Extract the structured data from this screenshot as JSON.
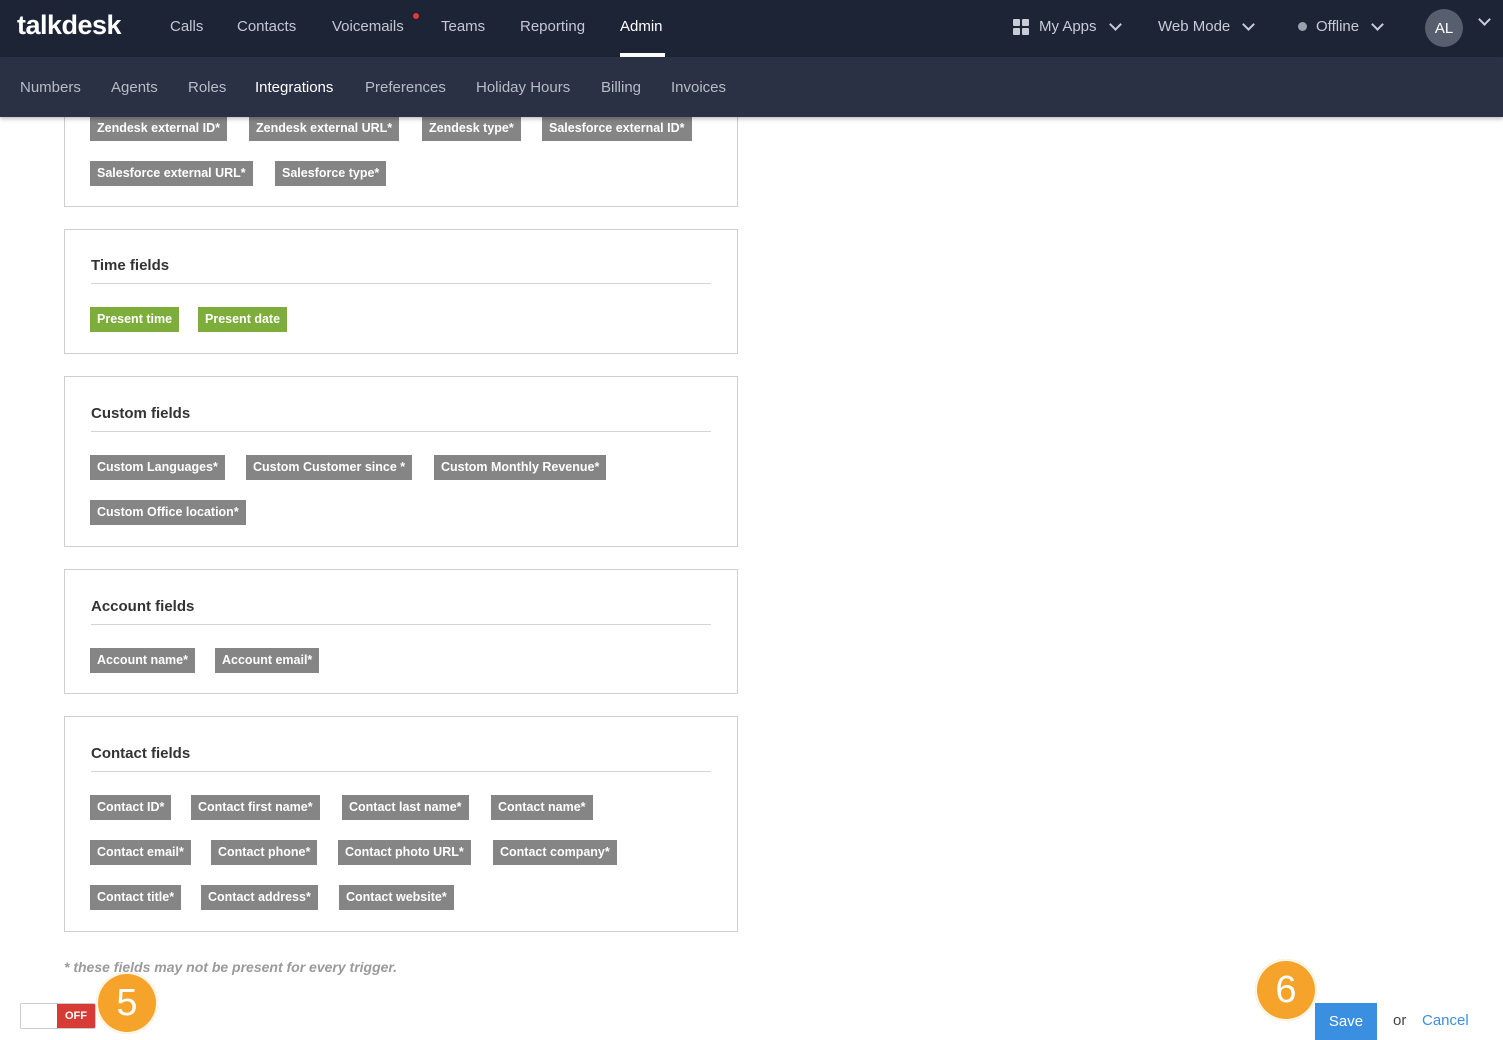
{
  "app": {
    "logo": "talkdesk"
  },
  "top_nav": {
    "items": [
      {
        "label": "Calls"
      },
      {
        "label": "Contacts"
      },
      {
        "label": "Voicemails"
      },
      {
        "label": "Teams"
      },
      {
        "label": "Reporting"
      },
      {
        "label": "Admin"
      }
    ],
    "active": "Admin",
    "my_apps": "My Apps",
    "web_mode": "Web Mode",
    "status": "Offline",
    "avatar_initials": "AL"
  },
  "sub_nav": {
    "items": [
      {
        "label": "Numbers"
      },
      {
        "label": "Agents"
      },
      {
        "label": "Roles"
      },
      {
        "label": "Integrations"
      },
      {
        "label": "Preferences"
      },
      {
        "label": "Holiday Hours"
      },
      {
        "label": "Billing"
      },
      {
        "label": "Invoices"
      }
    ],
    "active": "Integrations"
  },
  "sections": {
    "external": {
      "tags": [
        "Zendesk external ID*",
        "Zendesk external URL*",
        "Zendesk type*",
        "Salesforce external ID*",
        "Salesforce external URL*",
        "Salesforce type*"
      ]
    },
    "time": {
      "title": "Time fields",
      "tags": [
        "Present time",
        "Present date"
      ]
    },
    "custom": {
      "title": "Custom fields",
      "tags": [
        "Custom Languages*",
        "Custom Customer since *",
        "Custom Monthly Revenue*",
        "Custom Office location*"
      ]
    },
    "account": {
      "title": "Account fields",
      "tags": [
        "Account name*",
        "Account email*"
      ]
    },
    "contact": {
      "title": "Contact fields",
      "tags": [
        "Contact ID*",
        "Contact first name*",
        "Contact last name*",
        "Contact name*",
        "Contact email*",
        "Contact phone*",
        "Contact photo URL*",
        "Contact company*",
        "Contact title*",
        "Contact address*",
        "Contact website*"
      ]
    }
  },
  "footnote": "* these fields may not be present for every trigger.",
  "toggle": {
    "state_label": "OFF"
  },
  "step_badges": [
    "5",
    "6"
  ],
  "actions": {
    "save_label": "Save",
    "or_label": "or",
    "cancel_label": "Cancel"
  },
  "colors": {
    "nav_bg": "#1d2436",
    "subnav_bg": "#2a3144",
    "tag_gray": "#858585",
    "tag_green": "#7dad3a",
    "save_blue": "#3b8fe0",
    "toggle_red": "#d63c35",
    "badge_orange": "#f5a32a"
  }
}
